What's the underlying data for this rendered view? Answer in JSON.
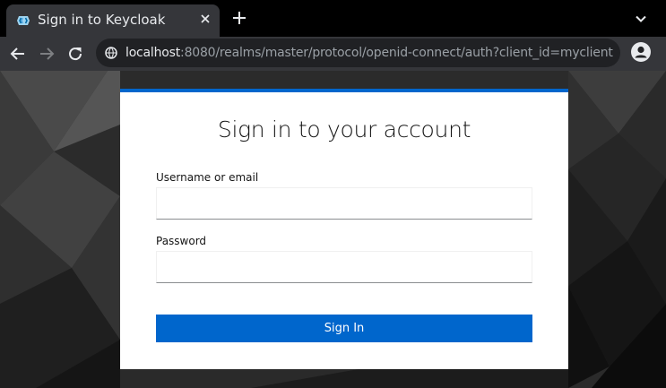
{
  "browser": {
    "tab_title": "Sign in to Keycloak",
    "url_host": "localhost",
    "url_rest": ":8080/realms/master/protocol/openid-connect/auth?client_id=myclient"
  },
  "login": {
    "heading": "Sign in to your account",
    "username_label": "Username or email",
    "username_value": "",
    "password_label": "Password",
    "password_value": "",
    "submit_label": "Sign In"
  },
  "colors": {
    "accent": "#0066cc",
    "chrome_dark": "#35363a",
    "omnibox": "#202124"
  },
  "icons": [
    "keycloak-favicon-icon",
    "close-icon",
    "plus-icon",
    "chevron-down-icon",
    "back-arrow-icon",
    "forward-arrow-icon",
    "reload-icon",
    "site-info-icon",
    "profile-icon"
  ]
}
